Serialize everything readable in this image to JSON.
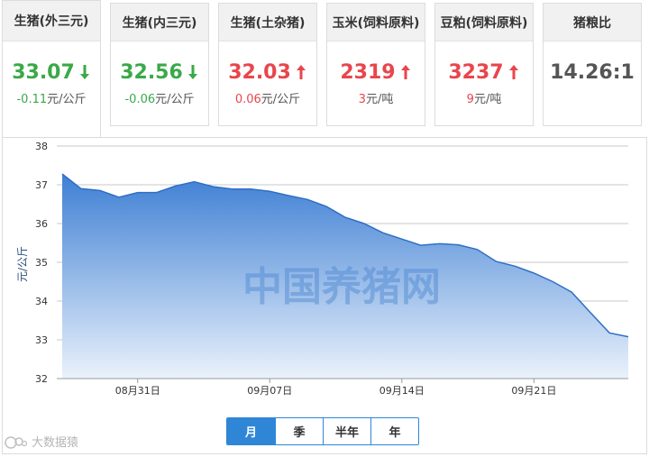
{
  "cards": [
    {
      "title": "生猪(外三元)",
      "value": "33.07",
      "direction": "down",
      "change": "-0.11",
      "unit": "元/公斤"
    },
    {
      "title": "生猪(内三元)",
      "value": "32.56",
      "direction": "down",
      "change": "-0.06",
      "unit": "元/公斤"
    },
    {
      "title": "生猪(土杂猪)",
      "value": "32.03",
      "direction": "up",
      "change": "0.06",
      "unit": "元/公斤"
    },
    {
      "title": "玉米(饲料原料)",
      "value": "2319",
      "direction": "up",
      "change": "3",
      "unit": "元/吨"
    },
    {
      "title": "豆粕(饲料原料)",
      "value": "3237",
      "direction": "up",
      "change": "9",
      "unit": "元/吨"
    },
    {
      "title": "猪粮比",
      "value": "14.26:1"
    }
  ],
  "colors": {
    "up": "#e8464b",
    "down": "#3aa948",
    "accent": "#2f86d6",
    "area_top": "#3e7fd4",
    "area_bottom": "#eaf2fb"
  },
  "chart_data": {
    "type": "area",
    "ylabel": "元/公斤",
    "xlabel": "",
    "ylim": [
      32,
      38
    ],
    "yticks": [
      32,
      33,
      34,
      35,
      36,
      37,
      38
    ],
    "grid": true,
    "xtick_labels": [
      {
        "index": 4,
        "label": "08月31日"
      },
      {
        "index": 11,
        "label": "09月07日"
      },
      {
        "index": 18,
        "label": "09月14日"
      },
      {
        "index": 25,
        "label": "09月21日"
      }
    ],
    "values": [
      37.28,
      36.9,
      36.85,
      36.68,
      36.8,
      36.8,
      36.97,
      37.08,
      36.95,
      36.89,
      36.89,
      36.83,
      36.72,
      36.62,
      36.44,
      36.16,
      36.0,
      35.76,
      35.6,
      35.44,
      35.48,
      35.45,
      35.33,
      35.02,
      34.9,
      34.72,
      34.5,
      34.23,
      33.7,
      33.18,
      33.08
    ]
  },
  "watermark": "中国养猪网",
  "range_tabs": {
    "items": [
      "月",
      "季",
      "半年",
      "年"
    ],
    "active": 0
  },
  "brand": {
    "text": "大数据猿"
  }
}
